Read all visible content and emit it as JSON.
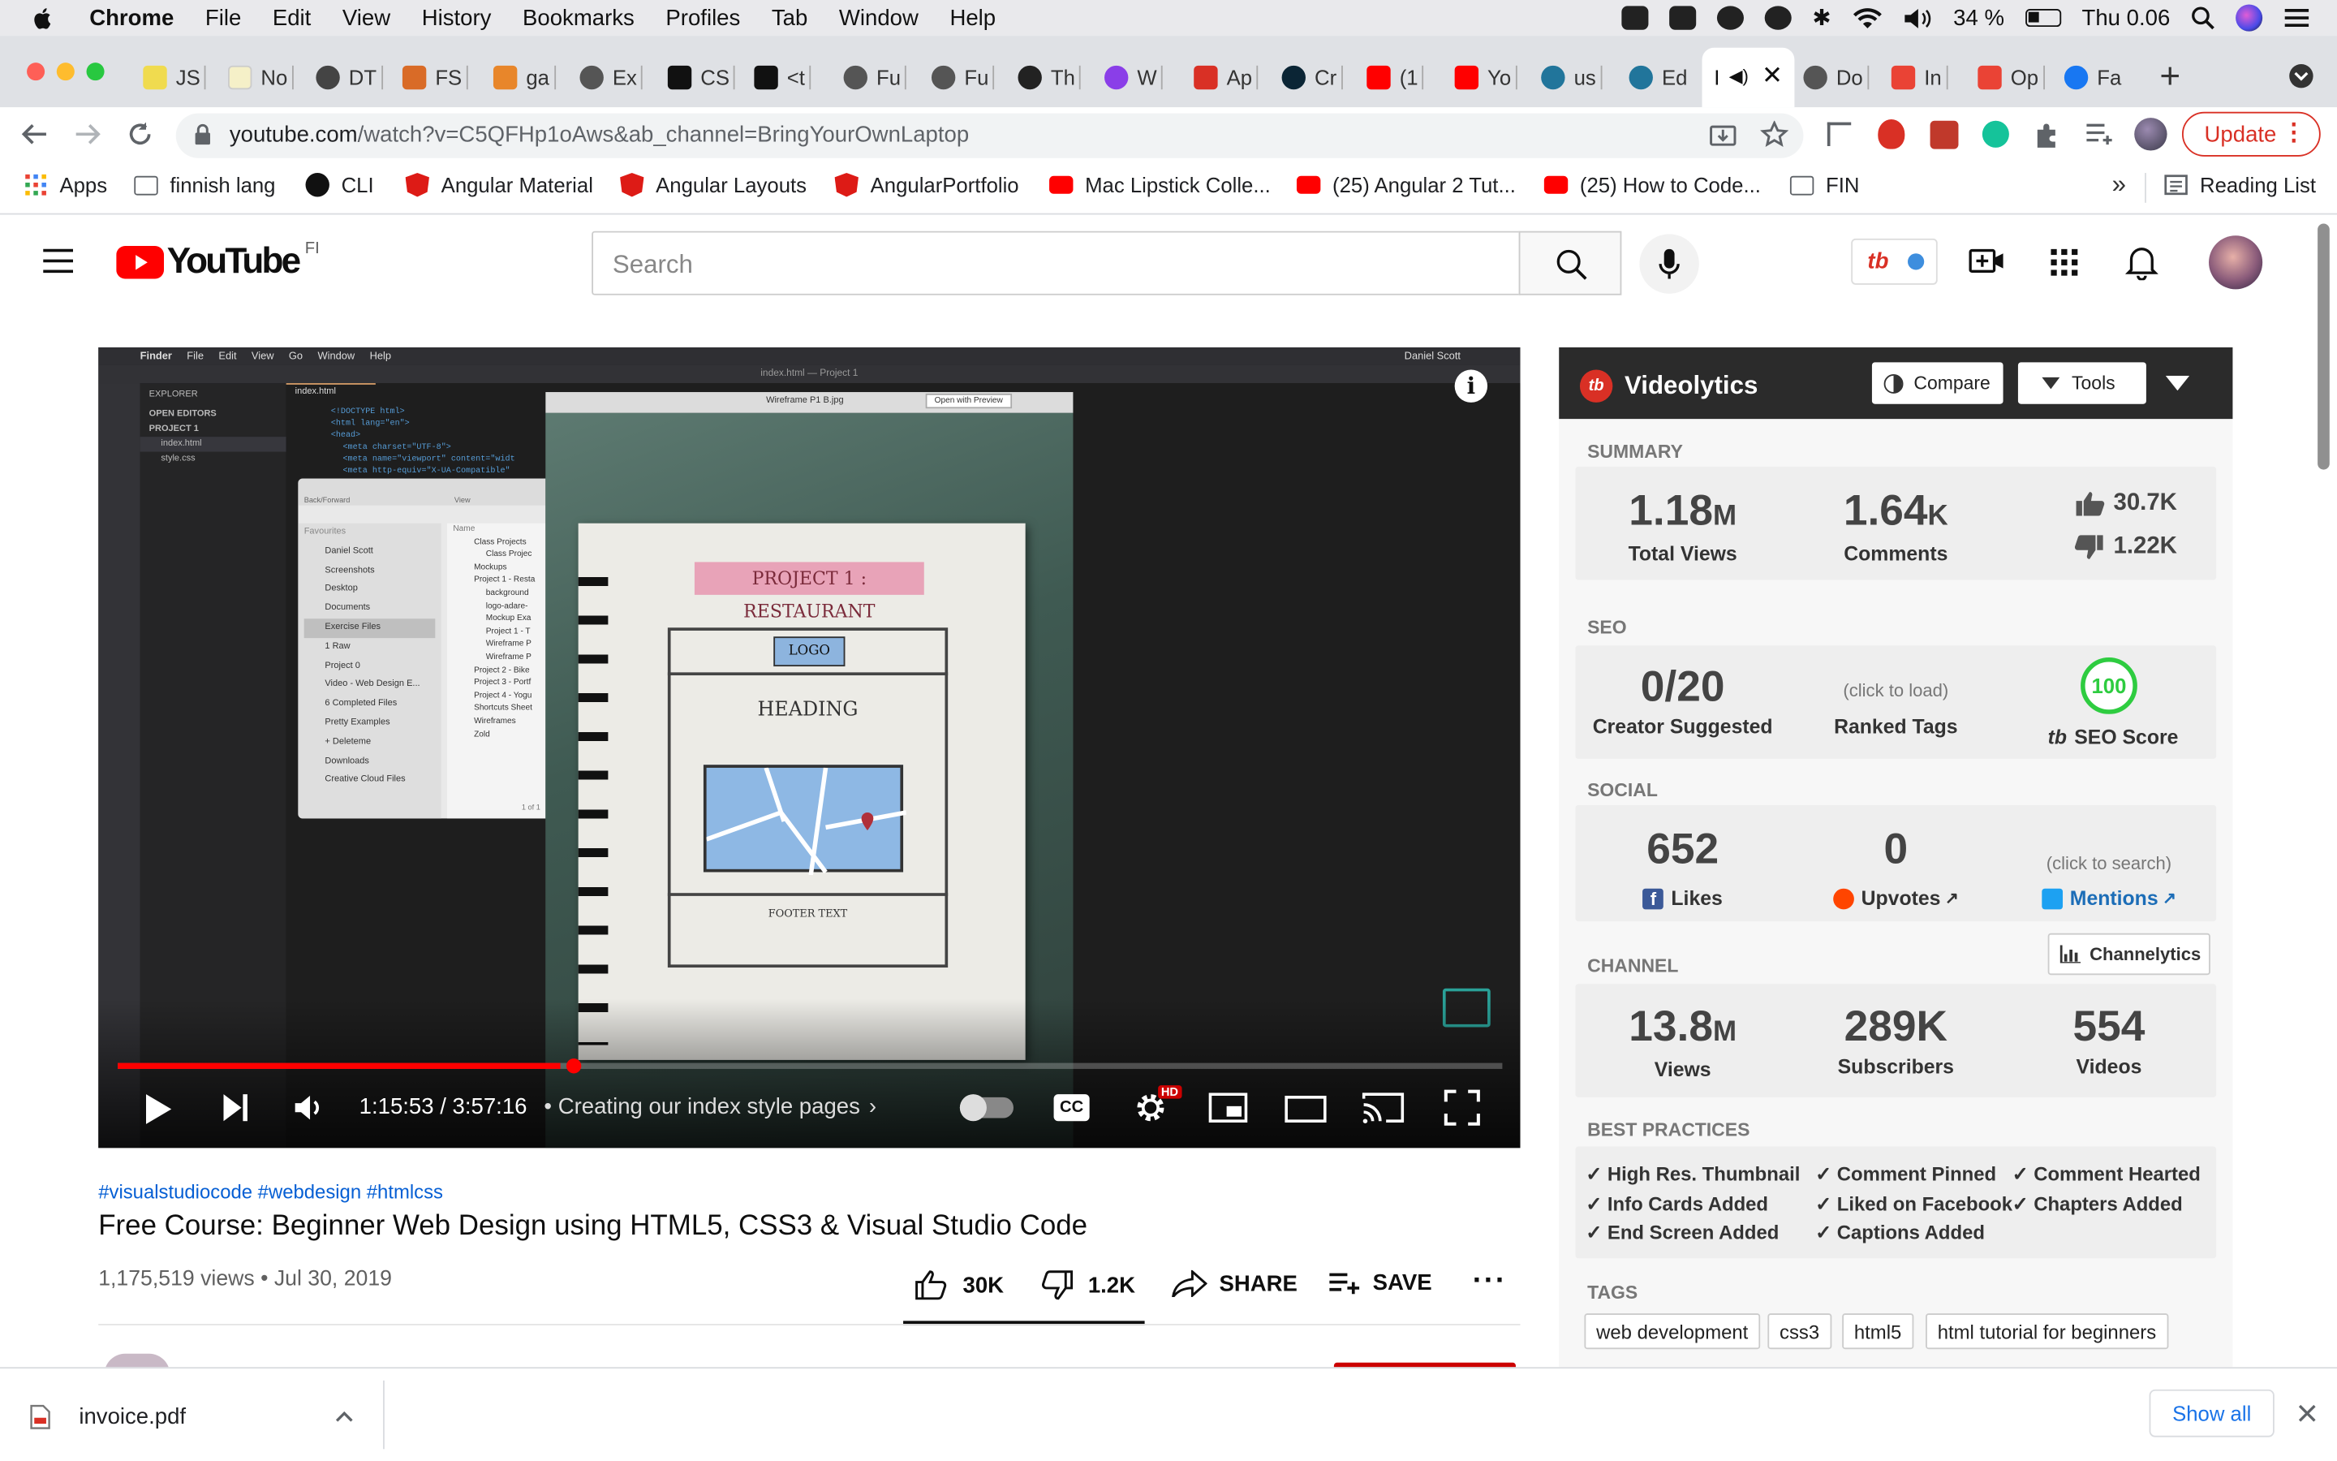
{
  "menubar": {
    "app_name": "Chrome",
    "items": [
      "File",
      "Edit",
      "View",
      "History",
      "Bookmarks",
      "Profiles",
      "Tab",
      "Window",
      "Help"
    ],
    "battery": "34 %",
    "clock": "Thu 0.06"
  },
  "tabs": [
    {
      "label": "JS",
      "color": "#f0db4f"
    },
    {
      "label": "No",
      "color": "#f5f0c8"
    },
    {
      "label": "DT",
      "color": "#444444"
    },
    {
      "label": "FS",
      "color": "#d96b27"
    },
    {
      "label": "ga",
      "color": "#e8862a"
    },
    {
      "label": "Ex",
      "color": "#555555"
    },
    {
      "label": "CS",
      "color": "#111111"
    },
    {
      "label": "<t",
      "color": "#111111"
    },
    {
      "label": "Fu",
      "color": "#555555"
    },
    {
      "label": "Fu",
      "color": "#555555"
    },
    {
      "label": "Th",
      "color": "#222222"
    },
    {
      "label": "W",
      "color": "#8a3ee8"
    },
    {
      "label": "Ap",
      "color": "#d93025"
    },
    {
      "label": "Cr",
      "color": "#0b2535"
    },
    {
      "label": "(1",
      "color": "#ff0000"
    },
    {
      "label": "Yo",
      "color": "#ff0000"
    },
    {
      "label": "us",
      "color": "#21759b"
    },
    {
      "label": "Ed",
      "color": "#21759b"
    },
    {
      "label": "Do",
      "color": "#555555"
    },
    {
      "label": "In",
      "color": "#ea4335"
    },
    {
      "label": "Op",
      "color": "#ea4335"
    },
    {
      "label": "Fa",
      "color": "#1877f2"
    }
  ],
  "active_tab": {
    "label": "I"
  },
  "toolbar": {
    "url_main": "youtube.com",
    "url_rest": "/watch?v=C5QFHp1oAws&ab_channel=BringYourOwnLaptop",
    "update_label": "Update"
  },
  "bookmarks": {
    "apps": "Apps",
    "items": [
      "finnish lang",
      "CLI",
      "Angular Material",
      "Angular Layouts",
      "AngularPortfolio",
      "Mac Lipstick Colle...",
      "(25) Angular 2 Tut...",
      "(25) How to Code...",
      "FIN"
    ],
    "more": "»",
    "reading_list": "Reading List"
  },
  "youtube": {
    "logo_text": "YouTube",
    "country": "FI",
    "search_placeholder": "Search"
  },
  "player": {
    "time_current": "1:15:53",
    "time_sep": " / ",
    "time_total": "3:57:16",
    "chapter": "Creating our index style pages",
    "hd_badge": "HD",
    "progress_fraction": 0.32,
    "screen": {
      "finder_menu": [
        "Finder",
        "File",
        "Edit",
        "View",
        "Go",
        "Window",
        "Help"
      ],
      "finder_user": "Daniel Scott",
      "window_title": "index.html — Project 1",
      "explorer_label": "EXPLORER",
      "open_editors": "OPEN EDITORS",
      "project": "PROJECT 1",
      "files": [
        "index.html",
        "style.css"
      ],
      "editor_tab": "index.html",
      "code_lines": [
        "<!DOCTYPE html>",
        "<html lang=\"en\">",
        "<head>",
        "<meta charset=\"UTF-8\">",
        "<meta name=\"viewport\" content=\"widt",
        "<meta http-equiv=\"X-UA-Compatible\""
      ],
      "preview_title": "Wireframe P1 B.jpg",
      "preview_button": "Open with Preview",
      "finder_header": "Back/Forward",
      "finder_view": "View",
      "finder_name_col": "Name",
      "finder_favourites": "Favourites",
      "finder_sidebar": [
        "Daniel Scott",
        "Screenshots",
        "Desktop",
        "Documents",
        "Exercise Files",
        "1 Raw",
        "Project 0",
        "Video - Web Design E...",
        "6 Completed Files",
        "Pretty Examples",
        "+ Deleteme",
        "Downloads",
        "Creative Cloud Files"
      ],
      "finder_items": [
        "Class Projects",
        "Class Projec",
        "Mockups",
        "Project 1 - Resta",
        "background",
        "logo-adare-",
        "Mockup Exa",
        "Project 1 - T",
        "Wireframe P",
        "Wireframe P",
        "Project 2 - Bike",
        "Project 3 - Portf",
        "Project 4 - Yogu",
        "Shortcuts Sheet",
        "Wireframes",
        "Zold"
      ],
      "finder_footer": "1 of 1",
      "sketch_title": "PROJECT 1 : RESTAURANT",
      "sketch_logo": "LOGO",
      "sketch_heading": "HEADING",
      "sketch_footer": "FOOTER TEXT"
    }
  },
  "video": {
    "hashtags": "#visualstudiocode #webdesign #htmlcss",
    "title": "Free Course: Beginner Web Design using HTML5, CSS3 & Visual Studio Code",
    "views": "1,175,519 views",
    "date_sep": " • ",
    "date": "Jul 30, 2019",
    "likes": "30K",
    "dislikes": "1.2K",
    "share": "SHARE",
    "save": "SAVE"
  },
  "videolytics": {
    "brand": "Videolytics",
    "compare": "Compare",
    "tools": "Tools",
    "summary_title": "SUMMARY",
    "total_views_num": "1.18",
    "total_views_unit": "M",
    "total_views_label": "Total Views",
    "comments_num": "1.64",
    "comments_unit": "K",
    "comments_label": "Comments",
    "likes": "30.7K",
    "dislikes": "1.22K",
    "seo_title": "SEO",
    "creator_suggested_num": "0/20",
    "creator_suggested_label": "Creator Suggested",
    "ranked_tags_hint": "(click to load)",
    "ranked_tags_label": "Ranked Tags",
    "seo_score": "100",
    "seo_score_label": "SEO Score",
    "social_title": "SOCIAL",
    "fb_likes": "652",
    "fb_likes_label": "Likes",
    "upvotes": "0",
    "upvotes_label": "Upvotes",
    "mentions_hint": "(click to search)",
    "mentions_label": "Mentions",
    "channel_title": "CHANNEL",
    "channelytics": "Channelytics",
    "channel_views_num": "13.8",
    "channel_views_unit": "M",
    "channel_views_label": "Views",
    "subscribers": "289K",
    "subscribers_label": "Subscribers",
    "videos": "554",
    "videos_label": "Videos",
    "best_practices_title": "BEST PRACTICES",
    "best_practices": [
      "✓ High Res. Thumbnail",
      "✓ Comment Pinned",
      "✓ Comment Hearted",
      "✓ Info Cards Added",
      "✓ Liked on Facebook",
      "✓ Chapters Added",
      "✓ End Screen Added",
      "✓ Captions Added"
    ],
    "tags_title": "TAGS",
    "tags": [
      "web development",
      "css3",
      "html5",
      "html tutorial for beginners"
    ]
  },
  "downloads": {
    "file": "invoice.pdf",
    "show_all": "Show all"
  }
}
